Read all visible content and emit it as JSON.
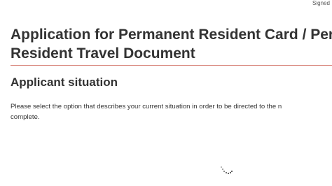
{
  "header": {
    "signed_in_text": "Signed"
  },
  "main": {
    "title_line1": "Application for Permanent Resident Card / Per",
    "title_line2": "Resident Travel Document",
    "section_heading": "Applicant situation",
    "instructions_line1": "Please select the option that describes your current situation in order to be directed to the n",
    "instructions_line2": "complete."
  },
  "colors": {
    "divider": "#d98980",
    "text": "#333333"
  },
  "icons": {
    "loading": "loading-spinner-icon"
  }
}
